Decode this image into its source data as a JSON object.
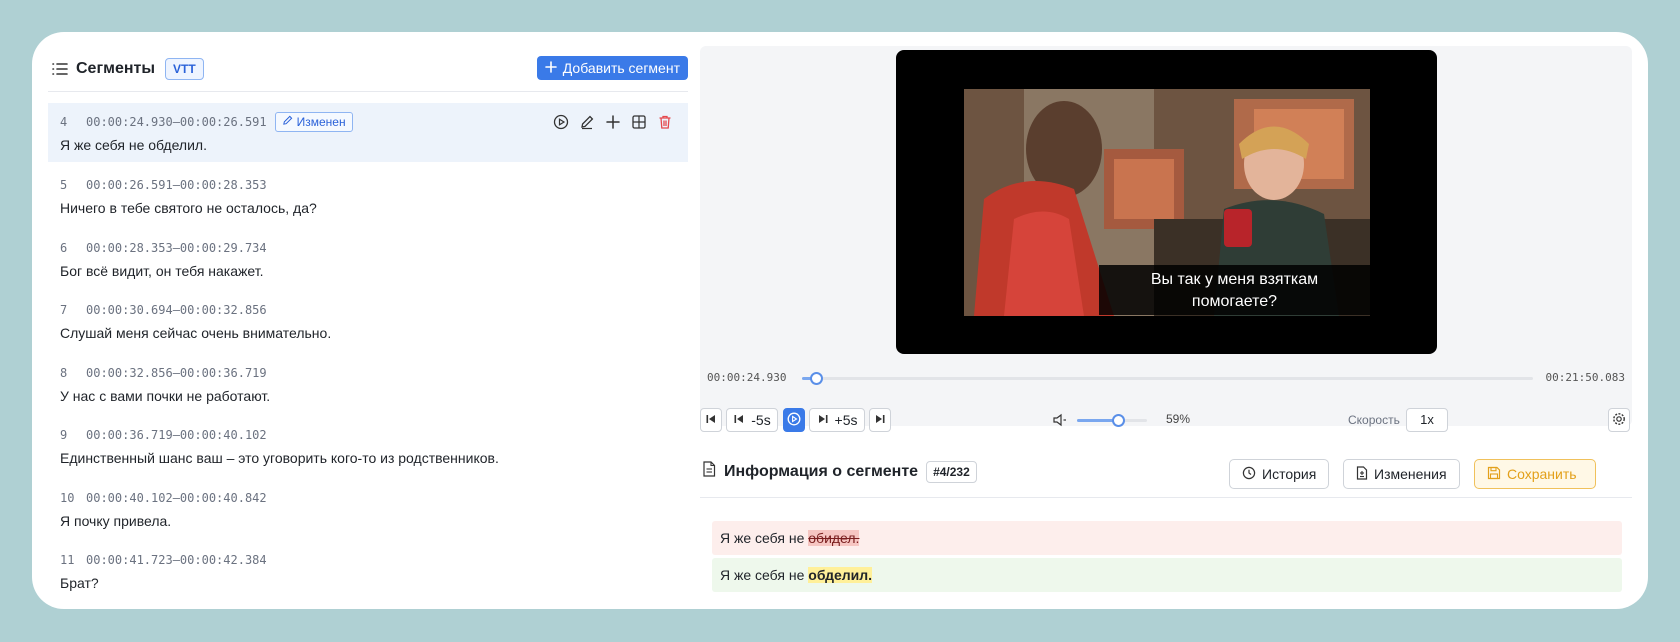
{
  "segments_panel": {
    "title": "Сегменты",
    "format_badge": "VTT",
    "add_button": "Добавить сегмент",
    "changed_badge": "Изменен",
    "items": [
      {
        "num": "4",
        "time": "00:00:24.930—00:00:26.591",
        "text": "Я же себя не обделил."
      },
      {
        "num": "5",
        "time": "00:00:26.591—00:00:28.353",
        "text": "Ничего в тебе святого не осталось, да?"
      },
      {
        "num": "6",
        "time": "00:00:28.353—00:00:29.734",
        "text": "Бог всё видит, он тебя накажет."
      },
      {
        "num": "7",
        "time": "00:00:30.694—00:00:32.856",
        "text": "Слушай меня сейчас очень внимательно."
      },
      {
        "num": "8",
        "time": "00:00:32.856—00:00:36.719",
        "text": "У нас с вами почки не работают."
      },
      {
        "num": "9",
        "time": "00:00:36.719—00:00:40.102",
        "text": "Единственный шанс ваш – это уговорить кого-то из родственников."
      },
      {
        "num": "10",
        "time": "00:00:40.102—00:00:40.842",
        "text": "Я почку привела."
      },
      {
        "num": "11",
        "time": "00:00:41.723—00:00:42.384",
        "text": "Брат?"
      }
    ]
  },
  "player": {
    "subtitle_line1": "Вы так у меня взяткам",
    "subtitle_line2": "помогаете?",
    "current_time": "00:00:24.930",
    "total_time": "00:21:50.083",
    "progress": 0.019,
    "back_label": "-5s",
    "forward_label": "+5s",
    "volume_percent": "59%",
    "volume": 0.59,
    "speed_label": "Скорость",
    "speed_value": "1x"
  },
  "segment_info": {
    "title": "Информация о сегменте",
    "count_badge": "#4/232",
    "history_button": "История",
    "changes_button": "Изменения",
    "save_button": "Сохранить",
    "old_prefix": "Я же себя не ",
    "old_removed": "обидел.",
    "new_prefix": "Я же себя не ",
    "new_added": "обделил."
  },
  "colors": {
    "accent": "#3a7ae8",
    "background": "#afd0d3",
    "delete": "#e5484d",
    "save": "#e3a01a"
  }
}
